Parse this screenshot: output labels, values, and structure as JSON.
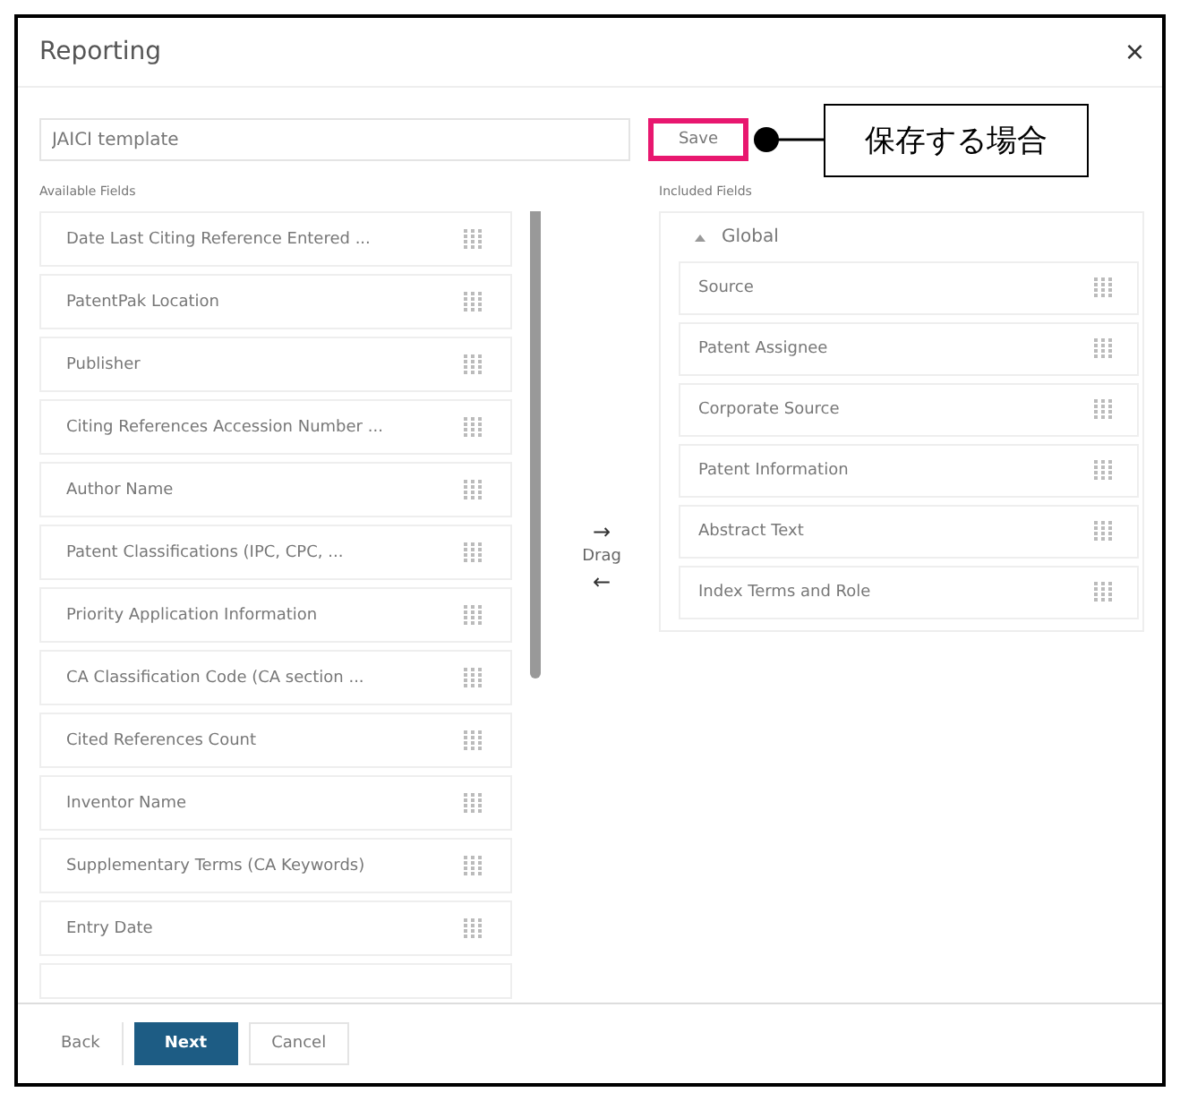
{
  "dialog": {
    "title": "Reporting",
    "close": "×"
  },
  "template_field": {
    "value": "JAICI template"
  },
  "save_button": {
    "label": "Save",
    "highlighted": true
  },
  "callout": {
    "text": "保存する場合"
  },
  "available_fields": {
    "label": "Available Fields",
    "items": [
      {
        "label": "Date Last Citing Reference Entered ..."
      },
      {
        "label": "PatentPak Location"
      },
      {
        "label": "Publisher"
      },
      {
        "label": "Citing References Accession Number ..."
      },
      {
        "label": "Author Name"
      },
      {
        "label": "Patent Classifications (IPC, CPC, ..."
      },
      {
        "label": "Priority Application Information"
      },
      {
        "label": "CA Classification Code (CA section ..."
      },
      {
        "label": "Cited References Count"
      },
      {
        "label": "Inventor Name"
      },
      {
        "label": "Supplementary Terms (CA Keywords)"
      },
      {
        "label": "Entry Date"
      }
    ]
  },
  "drag": {
    "right_arrow": "→",
    "label": "Drag",
    "left_arrow": "←"
  },
  "included_fields": {
    "label": "Included Fields",
    "group": {
      "label": "Global",
      "expanded": true,
      "items": [
        {
          "label": "Source"
        },
        {
          "label": "Patent Assignee"
        },
        {
          "label": "Corporate Source"
        },
        {
          "label": "Patent Information"
        },
        {
          "label": "Abstract Text"
        },
        {
          "label": "Index Terms and Role"
        }
      ]
    }
  },
  "footer": {
    "buttons": [
      {
        "label": "Back",
        "kind": "plain"
      },
      {
        "label": "Next",
        "kind": "primary"
      },
      {
        "label": "Cancel",
        "kind": "outline"
      }
    ]
  }
}
